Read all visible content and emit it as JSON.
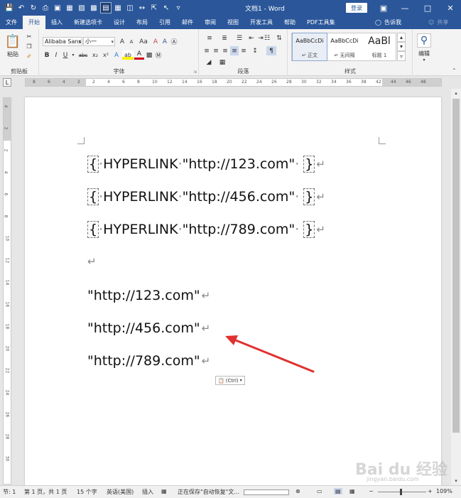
{
  "window": {
    "title": "文档1 - Word",
    "login_label": "登录",
    "qat_icons": [
      "save-icon",
      "undo-icon",
      "redo-icon",
      "print-preview-icon",
      "open-icon",
      "paste-icon",
      "copy-icon",
      "view-icon",
      "table-icon",
      "columns-icon",
      "spacing-icon",
      "select-icon",
      "customize-icon"
    ]
  },
  "tabs": [
    "文件",
    "开始",
    "插入",
    "新建选项卡",
    "设计",
    "布局",
    "引用",
    "邮件",
    "审阅",
    "视图",
    "开发工具",
    "帮助",
    "PDF工具集"
  ],
  "active_tab": "开始",
  "tell_me": "告诉我",
  "share": "共享",
  "ribbon": {
    "clipboard": {
      "label": "剪贴板",
      "paste": "粘贴"
    },
    "font": {
      "label": "字体",
      "font_name": "Alibaba Sans",
      "font_size": "小一",
      "grow": "A",
      "shrink": "A",
      "change_case": "Aa",
      "clear": "A",
      "bold": "B",
      "italic": "I",
      "underline": "U",
      "strike": "abc",
      "subscript": "x₂",
      "superscript": "x²",
      "text_effect": "A",
      "highlight": "ab",
      "font_color": "A",
      "phonetic": "A",
      "enclose": "A"
    },
    "paragraph": {
      "label": "段落"
    },
    "styles": {
      "label": "样式",
      "items": [
        {
          "sample": "AaBbCcDi",
          "name": "↵ 正文"
        },
        {
          "sample": "AaBbCcDi",
          "name": "↵ 无间隔"
        },
        {
          "sample": "AaBl",
          "name": "标题 1"
        }
      ]
    },
    "editing": {
      "label": "编辑"
    }
  },
  "ruler": {
    "corner": "L",
    "h_numbers": [
      "8",
      "6",
      "4",
      "2",
      "2",
      "4",
      "6",
      "8",
      "10",
      "12",
      "14",
      "16",
      "18",
      "20",
      "22",
      "24",
      "26",
      "28",
      "30",
      "32",
      "34",
      "36",
      "38",
      "42",
      "44",
      "46",
      "48"
    ],
    "v_numbers": [
      "4",
      "2",
      "2",
      "4",
      "6",
      "8",
      "10",
      "12",
      "14",
      "16",
      "18",
      "20",
      "22",
      "24",
      "26",
      "28",
      "30"
    ]
  },
  "document": {
    "field_lines": [
      {
        "open": "{",
        "keyword": "HYPERLINK",
        "url": "\"http://123.com\"",
        "close": "}"
      },
      {
        "open": "{",
        "keyword": "HYPERLINK",
        "url": "\"http://456.com\"",
        "close": "}"
      },
      {
        "open": "{",
        "keyword": "HYPERLINK",
        "url": "\"http://789.com\"",
        "close": "}"
      }
    ],
    "result_lines": [
      "\"http://123.com\"",
      "\"http://456.com\"",
      "\"http://789.com\""
    ],
    "paragraph_mark": "↵",
    "space_mark": "·",
    "paste_options": "(Ctrl)",
    "annotation_color": "#e03030"
  },
  "status": {
    "section": "节: 1",
    "page": "第 1 页，共 1 页",
    "words": "15 个字",
    "language": "英语(美国)",
    "mode": "插入",
    "saving": "正在保存\"自动恢复\"文...",
    "zoom": "109%"
  },
  "watermark": {
    "brand": "Bai du 经验",
    "sub": "jingyan.baidu.com"
  },
  "colors": {
    "accent": "#2b579a",
    "ribbon_bg": "#f3f3f3",
    "arrow": "#e03030"
  }
}
